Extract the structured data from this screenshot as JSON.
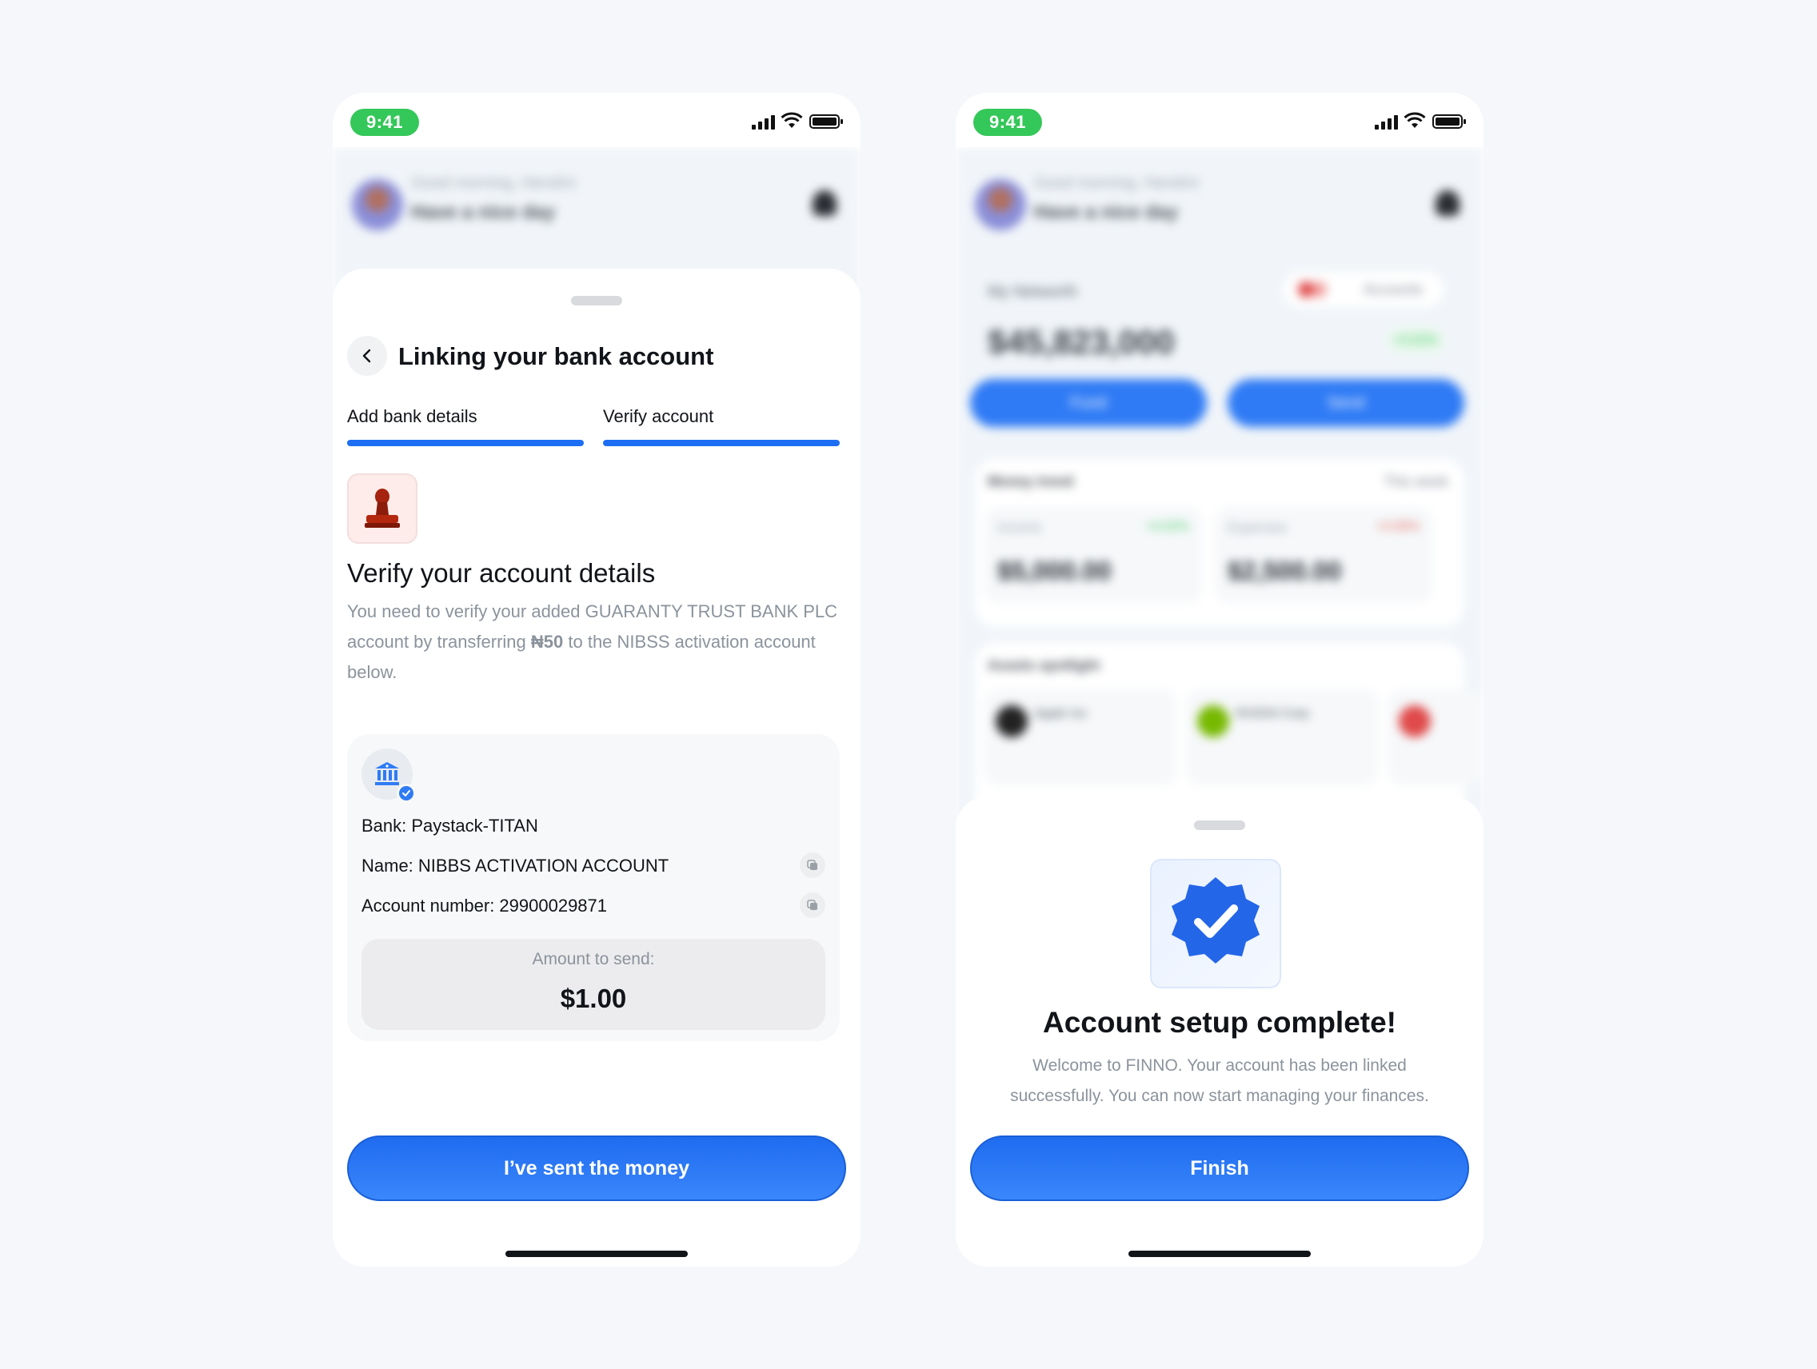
{
  "status_bar": {
    "time": "9:41"
  },
  "home_background": {
    "greeting": "Good morning, Hendrix",
    "tagline": "Have a nice day",
    "networth_label": "My Networth",
    "accounts_label": "Accounts",
    "networth_value": "$45,823,000",
    "networth_change": "+4.02%",
    "fund_label": "Fund",
    "send_label": "Send",
    "money_trend_label": "Money trend",
    "period_label": "This week",
    "income_label": "Income",
    "income_change": "+4.02%",
    "income_value": "$5,000.00",
    "expenses_label": "Expenses",
    "expenses_change": "+4.00%",
    "expenses_value": "$2,500.00",
    "assets_label": "Assets spotlight",
    "assets": [
      "Apple Inc",
      "NVIDIA Corp"
    ]
  },
  "linking_screen": {
    "title": "Linking your bank account",
    "steps": [
      {
        "label": "Add bank details",
        "complete": true
      },
      {
        "label": "Verify account",
        "complete": true
      }
    ],
    "verify_title": "Verify your account details",
    "verify_desc_part1": "You need to verify your added GUARANTY TRUST BANK PLC account by transferring ",
    "verify_desc_amount": "₦50",
    "verify_desc_part2": " to the NIBSS activation account below.",
    "bank_line": "Bank: Paystack-TITAN",
    "name_line": "Name: NIBBS ACTIVATION ACCOUNT",
    "account_number_line": "Account number: 29900029871",
    "amount_label": "Amount to send:",
    "amount_value": "$1.00",
    "cta_label": "I’ve sent the money"
  },
  "complete_screen": {
    "title": "Account setup complete!",
    "description": "Welcome to FINNO. Your account has been linked successfully. You can now start managing your finances.",
    "cta_label": "Finish"
  },
  "colors": {
    "primary": "#1e6ef3",
    "status_green": "#34c759",
    "text_muted": "#8b939c"
  },
  "icons": [
    "signal-icon",
    "wifi-icon",
    "battery-icon",
    "back-arrow-icon",
    "stamp-icon",
    "bank-icon",
    "verified-check-icon",
    "copy-icon",
    "verified-badge-icon",
    "bell-icon"
  ]
}
